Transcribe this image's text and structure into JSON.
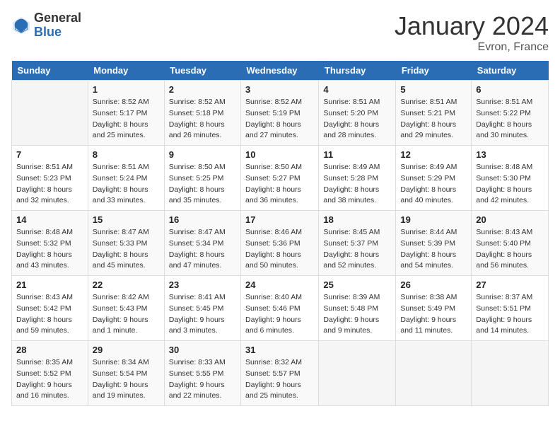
{
  "header": {
    "logo_general": "General",
    "logo_blue": "Blue",
    "month": "January 2024",
    "location": "Evron, France"
  },
  "days_of_week": [
    "Sunday",
    "Monday",
    "Tuesday",
    "Wednesday",
    "Thursday",
    "Friday",
    "Saturday"
  ],
  "weeks": [
    [
      {
        "day": "",
        "sunrise": "",
        "sunset": "",
        "daylight": ""
      },
      {
        "day": "1",
        "sunrise": "Sunrise: 8:52 AM",
        "sunset": "Sunset: 5:17 PM",
        "daylight": "Daylight: 8 hours and 25 minutes."
      },
      {
        "day": "2",
        "sunrise": "Sunrise: 8:52 AM",
        "sunset": "Sunset: 5:18 PM",
        "daylight": "Daylight: 8 hours and 26 minutes."
      },
      {
        "day": "3",
        "sunrise": "Sunrise: 8:52 AM",
        "sunset": "Sunset: 5:19 PM",
        "daylight": "Daylight: 8 hours and 27 minutes."
      },
      {
        "day": "4",
        "sunrise": "Sunrise: 8:51 AM",
        "sunset": "Sunset: 5:20 PM",
        "daylight": "Daylight: 8 hours and 28 minutes."
      },
      {
        "day": "5",
        "sunrise": "Sunrise: 8:51 AM",
        "sunset": "Sunset: 5:21 PM",
        "daylight": "Daylight: 8 hours and 29 minutes."
      },
      {
        "day": "6",
        "sunrise": "Sunrise: 8:51 AM",
        "sunset": "Sunset: 5:22 PM",
        "daylight": "Daylight: 8 hours and 30 minutes."
      }
    ],
    [
      {
        "day": "7",
        "sunrise": "Sunrise: 8:51 AM",
        "sunset": "Sunset: 5:23 PM",
        "daylight": "Daylight: 8 hours and 32 minutes."
      },
      {
        "day": "8",
        "sunrise": "Sunrise: 8:51 AM",
        "sunset": "Sunset: 5:24 PM",
        "daylight": "Daylight: 8 hours and 33 minutes."
      },
      {
        "day": "9",
        "sunrise": "Sunrise: 8:50 AM",
        "sunset": "Sunset: 5:25 PM",
        "daylight": "Daylight: 8 hours and 35 minutes."
      },
      {
        "day": "10",
        "sunrise": "Sunrise: 8:50 AM",
        "sunset": "Sunset: 5:27 PM",
        "daylight": "Daylight: 8 hours and 36 minutes."
      },
      {
        "day": "11",
        "sunrise": "Sunrise: 8:49 AM",
        "sunset": "Sunset: 5:28 PM",
        "daylight": "Daylight: 8 hours and 38 minutes."
      },
      {
        "day": "12",
        "sunrise": "Sunrise: 8:49 AM",
        "sunset": "Sunset: 5:29 PM",
        "daylight": "Daylight: 8 hours and 40 minutes."
      },
      {
        "day": "13",
        "sunrise": "Sunrise: 8:48 AM",
        "sunset": "Sunset: 5:30 PM",
        "daylight": "Daylight: 8 hours and 42 minutes."
      }
    ],
    [
      {
        "day": "14",
        "sunrise": "Sunrise: 8:48 AM",
        "sunset": "Sunset: 5:32 PM",
        "daylight": "Daylight: 8 hours and 43 minutes."
      },
      {
        "day": "15",
        "sunrise": "Sunrise: 8:47 AM",
        "sunset": "Sunset: 5:33 PM",
        "daylight": "Daylight: 8 hours and 45 minutes."
      },
      {
        "day": "16",
        "sunrise": "Sunrise: 8:47 AM",
        "sunset": "Sunset: 5:34 PM",
        "daylight": "Daylight: 8 hours and 47 minutes."
      },
      {
        "day": "17",
        "sunrise": "Sunrise: 8:46 AM",
        "sunset": "Sunset: 5:36 PM",
        "daylight": "Daylight: 8 hours and 50 minutes."
      },
      {
        "day": "18",
        "sunrise": "Sunrise: 8:45 AM",
        "sunset": "Sunset: 5:37 PM",
        "daylight": "Daylight: 8 hours and 52 minutes."
      },
      {
        "day": "19",
        "sunrise": "Sunrise: 8:44 AM",
        "sunset": "Sunset: 5:39 PM",
        "daylight": "Daylight: 8 hours and 54 minutes."
      },
      {
        "day": "20",
        "sunrise": "Sunrise: 8:43 AM",
        "sunset": "Sunset: 5:40 PM",
        "daylight": "Daylight: 8 hours and 56 minutes."
      }
    ],
    [
      {
        "day": "21",
        "sunrise": "Sunrise: 8:43 AM",
        "sunset": "Sunset: 5:42 PM",
        "daylight": "Daylight: 8 hours and 59 minutes."
      },
      {
        "day": "22",
        "sunrise": "Sunrise: 8:42 AM",
        "sunset": "Sunset: 5:43 PM",
        "daylight": "Daylight: 9 hours and 1 minute."
      },
      {
        "day": "23",
        "sunrise": "Sunrise: 8:41 AM",
        "sunset": "Sunset: 5:45 PM",
        "daylight": "Daylight: 9 hours and 3 minutes."
      },
      {
        "day": "24",
        "sunrise": "Sunrise: 8:40 AM",
        "sunset": "Sunset: 5:46 PM",
        "daylight": "Daylight: 9 hours and 6 minutes."
      },
      {
        "day": "25",
        "sunrise": "Sunrise: 8:39 AM",
        "sunset": "Sunset: 5:48 PM",
        "daylight": "Daylight: 9 hours and 9 minutes."
      },
      {
        "day": "26",
        "sunrise": "Sunrise: 8:38 AM",
        "sunset": "Sunset: 5:49 PM",
        "daylight": "Daylight: 9 hours and 11 minutes."
      },
      {
        "day": "27",
        "sunrise": "Sunrise: 8:37 AM",
        "sunset": "Sunset: 5:51 PM",
        "daylight": "Daylight: 9 hours and 14 minutes."
      }
    ],
    [
      {
        "day": "28",
        "sunrise": "Sunrise: 8:35 AM",
        "sunset": "Sunset: 5:52 PM",
        "daylight": "Daylight: 9 hours and 16 minutes."
      },
      {
        "day": "29",
        "sunrise": "Sunrise: 8:34 AM",
        "sunset": "Sunset: 5:54 PM",
        "daylight": "Daylight: 9 hours and 19 minutes."
      },
      {
        "day": "30",
        "sunrise": "Sunrise: 8:33 AM",
        "sunset": "Sunset: 5:55 PM",
        "daylight": "Daylight: 9 hours and 22 minutes."
      },
      {
        "day": "31",
        "sunrise": "Sunrise: 8:32 AM",
        "sunset": "Sunset: 5:57 PM",
        "daylight": "Daylight: 9 hours and 25 minutes."
      },
      {
        "day": "",
        "sunrise": "",
        "sunset": "",
        "daylight": ""
      },
      {
        "day": "",
        "sunrise": "",
        "sunset": "",
        "daylight": ""
      },
      {
        "day": "",
        "sunrise": "",
        "sunset": "",
        "daylight": ""
      }
    ]
  ]
}
